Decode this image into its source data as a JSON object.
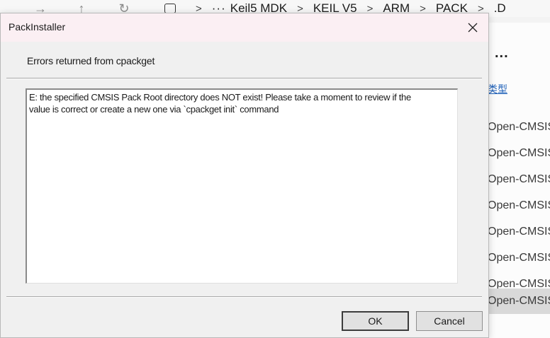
{
  "explorer": {
    "breadcrumb": [
      "Keil5 MDK",
      "KEIL V5",
      "ARM",
      "PACK",
      ".D"
    ],
    "more_label": "...",
    "type_header": "类型",
    "type_items": [
      "Open-CMSIS",
      "Open-CMSIS",
      "Open-CMSIS",
      "Open-CMSIS",
      "Open-CMSIS",
      "Open-CMSIS",
      "Open-CMSIS",
      "Open-CMSIS"
    ],
    "selected_index": 7
  },
  "dialog": {
    "title": "PackInstaller",
    "heading": "Errors returned from cpackget",
    "message": "E: the specified CMSIS Pack Root directory does NOT exist! Please take a moment to review if the\nvalue is correct or create a new one via `cpackget init` command",
    "ok_label": "OK",
    "cancel_label": "Cancel"
  },
  "icons": {
    "back": "back-arrow-icon",
    "up": "up-arrow-icon",
    "refresh": "refresh-icon",
    "close": "close-icon"
  }
}
